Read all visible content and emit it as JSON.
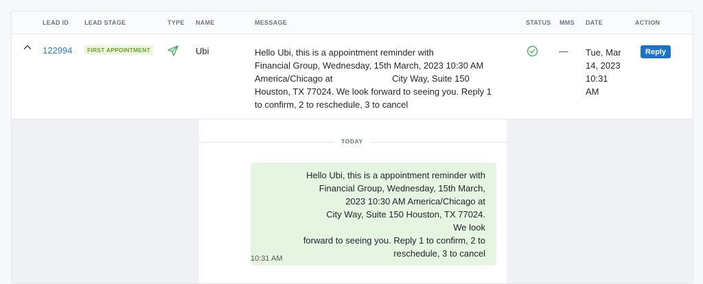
{
  "table": {
    "headers": {
      "lead_id": "LEAD ID",
      "lead_stage": "LEAD STAGE",
      "type": "TYPE",
      "name": "NAME",
      "message": "MESSAGE",
      "status": "STATUS",
      "mms": "MMS",
      "date": "DATE",
      "action": "ACTION"
    },
    "row": {
      "lead_id": "122994",
      "lead_stage": "FIRST APPOINTMENT",
      "type_icon": "send-icon",
      "name": "Ubi",
      "message": "Hello Ubi, this is a appointment reminder with\nFinancial Group, Wednesday, 15th March, 2023 10:30 AM\nAmerica/Chicago at                        City Way, Suite 150\nHouston, TX 77024. We look forward to seeing you. Reply 1\nto confirm, 2 to reschedule, 3 to cancel",
      "status_icon": "check-circle-icon",
      "mms": "—",
      "date": "Tue, Mar\n14, 2023\n10:31\nAM",
      "action_label": "Reply"
    }
  },
  "thread": {
    "day_label": "TODAY",
    "bubble_text": "Hello Ubi, this is a appointment reminder with\n                    Financial Group, Wednesday, 15th March,\n2023 10:30 AM America/Chicago at\n                    City Way, Suite 150 Houston, TX 77024. We look\nforward to seeing you. Reply 1 to confirm, 2 to\nreschedule, 3 to cancel",
    "time": "10:31 AM"
  },
  "colors": {
    "link": "#2d7cc4",
    "stage_text": "#6aa32b",
    "stage_bg": "#eef6e2",
    "accent": "#1a73c9",
    "bubble": "#e6f4e2",
    "status_ok": "#3aa856"
  }
}
